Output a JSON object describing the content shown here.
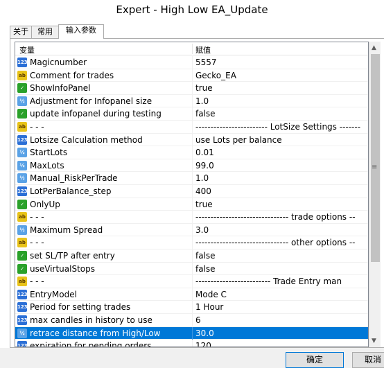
{
  "window": {
    "title": "Expert - High Low EA_Update"
  },
  "tabs": [
    {
      "label": "关于"
    },
    {
      "label": "常用"
    },
    {
      "label": "输入参数"
    }
  ],
  "grid": {
    "col_variable": "变量",
    "col_value": "赋值",
    "rows": [
      {
        "icon": "int-icon",
        "icon_text": "123",
        "name": "Magicnumber",
        "value": "5557"
      },
      {
        "icon": "string-icon",
        "icon_text": "ab",
        "name": "Comment for trades",
        "value": "Gecko_EA"
      },
      {
        "icon": "bool-icon",
        "icon_text": "✓",
        "name": "ShowInfoPanel",
        "value": "true"
      },
      {
        "icon": "double-icon",
        "icon_text": "½",
        "name": "Adjustment for Infopanel size",
        "value": "1.0"
      },
      {
        "icon": "bool-icon",
        "icon_text": "✓",
        "name": "update infopanel during testing",
        "value": "false"
      },
      {
        "icon": "string-icon",
        "icon_text": "ab",
        "name": "- - -",
        "value": "------------------------ LotSize Settings -------"
      },
      {
        "icon": "int-icon",
        "icon_text": "123",
        "name": "Lotsize Calculation method",
        "value": "use Lots per balance"
      },
      {
        "icon": "double-icon",
        "icon_text": "½",
        "name": "StartLots",
        "value": "0.01"
      },
      {
        "icon": "double-icon",
        "icon_text": "½",
        "name": "MaxLots",
        "value": "99.0"
      },
      {
        "icon": "double-icon",
        "icon_text": "½",
        "name": "Manual_RiskPerTrade",
        "value": "1.0"
      },
      {
        "icon": "int-icon",
        "icon_text": "123",
        "name": "LotPerBalance_step",
        "value": "400"
      },
      {
        "icon": "bool-icon",
        "icon_text": "✓",
        "name": "OnlyUp",
        "value": "true"
      },
      {
        "icon": "string-icon",
        "icon_text": "ab",
        "name": "- - -",
        "value": "------------------------------- trade options --"
      },
      {
        "icon": "double-icon",
        "icon_text": "½",
        "name": "Maximum Spread",
        "value": "3.0"
      },
      {
        "icon": "string-icon",
        "icon_text": "ab",
        "name": "- - -",
        "value": "------------------------------- other options --"
      },
      {
        "icon": "bool-icon",
        "icon_text": "✓",
        "name": "set SL/TP after entry",
        "value": "false"
      },
      {
        "icon": "bool-icon",
        "icon_text": "✓",
        "name": "useVirtualStops",
        "value": "false"
      },
      {
        "icon": "string-icon",
        "icon_text": "ab",
        "name": "- - -",
        "value": "------------------------- Trade Entry man"
      },
      {
        "icon": "int-icon",
        "icon_text": "123",
        "name": "EntryModel",
        "value": "Mode C"
      },
      {
        "icon": "int-icon",
        "icon_text": "123",
        "name": "Period for setting trades",
        "value": "1 Hour"
      },
      {
        "icon": "int-icon",
        "icon_text": "123",
        "name": "max candles in history to use",
        "value": "6"
      },
      {
        "icon": "double-icon",
        "icon_text": "½",
        "name": "retrace distance from High/Low",
        "value": "30.0",
        "selected": true
      },
      {
        "icon": "int-icon",
        "icon_text": "123",
        "name": "expiration for pending orders",
        "value": "120"
      }
    ]
  },
  "buttons": {
    "ok": "确定",
    "cancel": "取消"
  },
  "colors": {
    "selection": "#0078d7",
    "int_icon": "#2b6fd6",
    "double_icon": "#5aa2e6",
    "string_icon": "#e8c31a",
    "bool_icon": "#2aa12a"
  }
}
